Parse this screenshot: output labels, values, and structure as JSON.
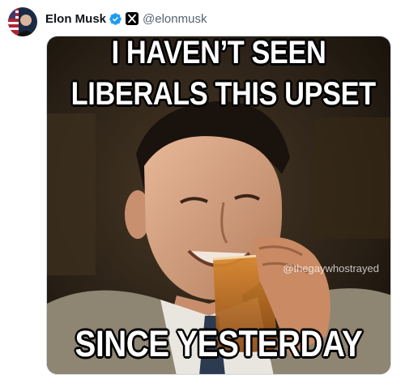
{
  "post": {
    "author": {
      "display_name": "Elon Musk",
      "handle": "@elonmusk",
      "avatar_icon": "avatar-photo",
      "verified_icon": "verified-badge-icon",
      "affiliate_icon": "x-logo-icon"
    },
    "media": {
      "caption_line1": "I HAVEN’T SEEN",
      "caption_line2": "LIBERALS THIS UPSET",
      "caption_bottom": "SINCE YESTERDAY",
      "watermark": "@thegaywhostrayed"
    }
  },
  "colors": {
    "name_text": "#0f1419",
    "handle_text": "#536471",
    "verified_blue": "#1d9bf0",
    "media_border": "#cfd9de"
  }
}
